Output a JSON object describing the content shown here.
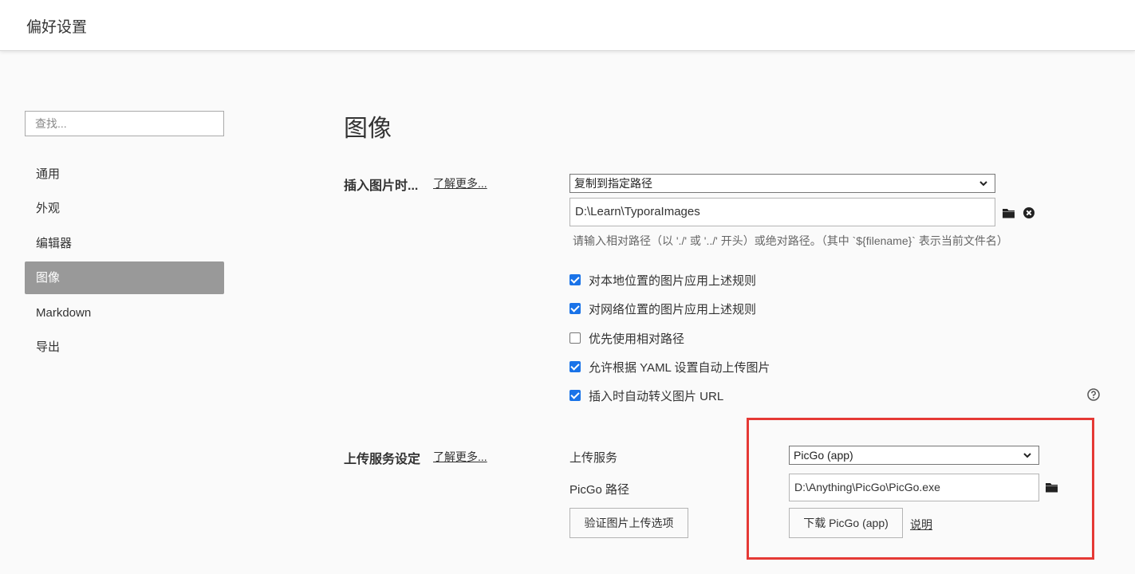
{
  "header": {
    "title": "偏好设置"
  },
  "sidebar": {
    "search_placeholder": "查找...",
    "items": [
      {
        "label": "通用",
        "active": false
      },
      {
        "label": "外观",
        "active": false
      },
      {
        "label": "编辑器",
        "active": false
      },
      {
        "label": "图像",
        "active": true
      },
      {
        "label": "Markdown",
        "active": false
      },
      {
        "label": "导出",
        "active": false
      }
    ]
  },
  "main": {
    "title": "图像",
    "insert": {
      "label": "插入图片时...",
      "learn_more": "了解更多...",
      "action_select": "复制到指定路径",
      "path_value": "D:\\Learn\\TyporaImages",
      "hint": "请输入相对路径（以 './' 或 '../' 开头）或绝对路径。（其中 `${filename}` 表示当前文件名）",
      "icons": [
        "folder-icon",
        "clear-icon"
      ],
      "options": [
        {
          "label": "对本地位置的图片应用上述规则",
          "checked": true
        },
        {
          "label": "对网络位置的图片应用上述规则",
          "checked": true
        },
        {
          "label": "优先使用相对路径",
          "checked": false
        },
        {
          "label": "允许根据 YAML 设置自动上传图片",
          "checked": true
        },
        {
          "label": "插入时自动转义图片 URL",
          "checked": true
        }
      ]
    },
    "upload": {
      "label": "上传服务设定",
      "learn_more": "了解更多...",
      "service_label": "上传服务",
      "service_value": "PicGo (app)",
      "path_label": "PicGo 路径",
      "path_value": "D:\\Anything\\PicGo\\PicGo.exe",
      "verify_button": "验证图片上传选项",
      "download_button": "下载 PicGo (app)",
      "doc_link": "说明"
    }
  },
  "colors": {
    "accent": "#1a73e8",
    "active_nav": "#999999",
    "highlight": "#e53935"
  }
}
